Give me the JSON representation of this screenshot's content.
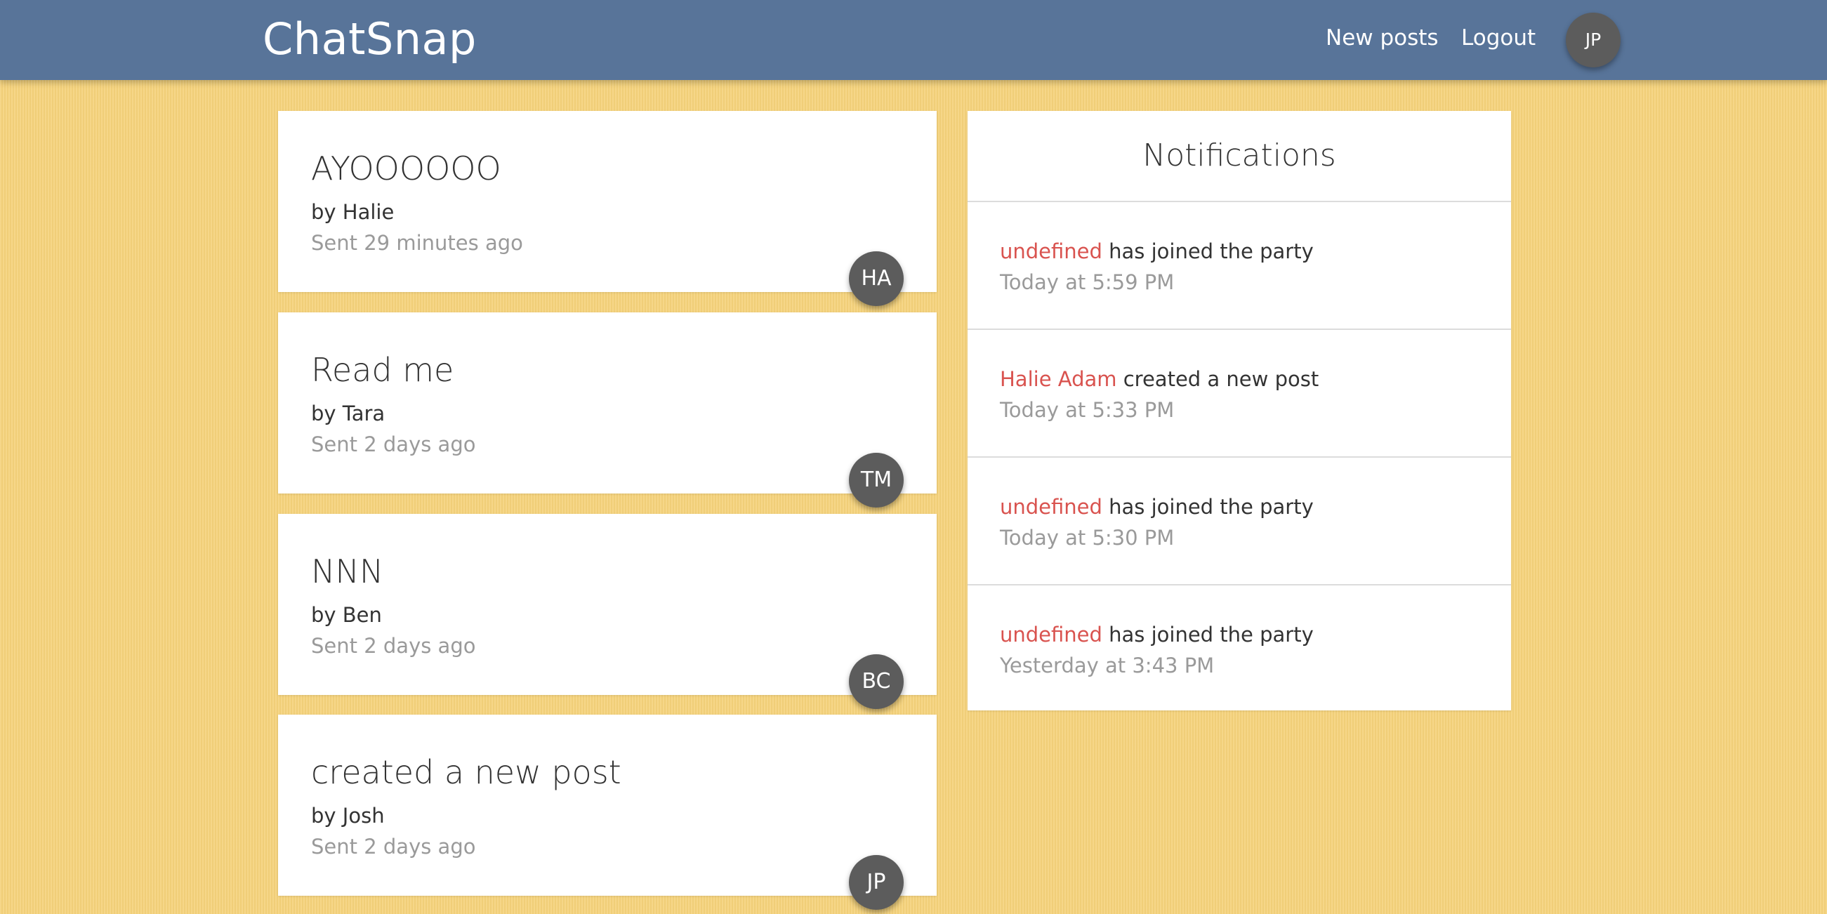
{
  "navbar": {
    "brand": "ChatSnap",
    "new_posts": "New posts",
    "logout": "Logout",
    "user_initials": "JP",
    "background": "#587499"
  },
  "posts": [
    {
      "title": "AYOOOOOO",
      "author": "by Halie",
      "sent": "Sent 29 minutes ago",
      "initials": "HA"
    },
    {
      "title": "Read me",
      "author": "by Tara",
      "sent": "Sent 2 days ago",
      "initials": "TM"
    },
    {
      "title": "NNN",
      "author": "by Ben",
      "sent": "Sent 2 days ago",
      "initials": "BC"
    },
    {
      "title": "created a new post",
      "author": "by Josh",
      "sent": "Sent 2 days ago",
      "initials": "JP"
    }
  ],
  "notifications": {
    "title": "Notifications",
    "items": [
      {
        "name": "undefined",
        "action": " has joined the party",
        "time": "Today at 5:59 PM"
      },
      {
        "name": "Halie Adam",
        "action": " created a new post",
        "time": "Today at 5:33 PM"
      },
      {
        "name": "undefined",
        "action": " has joined the party",
        "time": "Today at 5:30 PM"
      },
      {
        "name": "undefined",
        "action": " has joined the party",
        "time": "Yesterday at 3:43 PM"
      }
    ]
  },
  "colors": {
    "page_background": "#f5d27a",
    "accent_name": "#d9534f",
    "avatar": "#5c5c5c",
    "muted_text": "#9a9a9a"
  }
}
